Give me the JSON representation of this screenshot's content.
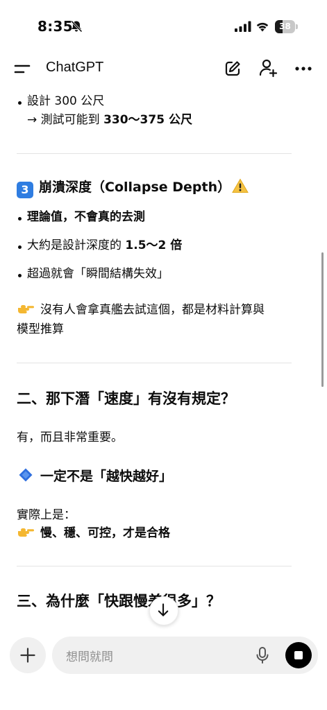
{
  "status_bar": {
    "time": "8:35",
    "battery_level": "38",
    "icons": [
      "bell-slash-icon",
      "signal-icon",
      "wifi-icon",
      "battery-icon"
    ]
  },
  "header": {
    "title": "ChatGPT",
    "icons": [
      "menu-icon",
      "compose-icon",
      "add-person-icon",
      "more-icon"
    ]
  },
  "message": {
    "design_line": "設計 300 公尺",
    "test_line_prefix": "→ 測試可能到 ",
    "test_line_bold": "330～375 公尺",
    "section3_keycap": "3",
    "section3_title": "崩潰深度（Collapse Depth）",
    "section3_items": [
      "理論值，不會真的去測",
      "大約是設計深度的 ",
      "超過就會「瞬間結構失效」"
    ],
    "section3_item2_bold": "1.5～2 倍",
    "section3_note_line1": "沒有人會拿真艦去試這個，都是材料計算與",
    "section3_note_line2": "模型推算",
    "heading2": "二、那下潛「速度」有沒有規定？",
    "answer": "有，而且非常重要。",
    "subheading": "一定不是「越快越好」",
    "actually": "實際上是：",
    "actually_bold": "慢、穩、可控，才是合格",
    "heading3": "三、為什麼「快跟慢差很多」？"
  },
  "composer": {
    "placeholder": "想問就問"
  },
  "colors": {
    "keycap_blue": "#2f7de1",
    "diamond_blue": "#2f6fde",
    "warning_yellow": "#f5c242",
    "point_yellow": "#f4b731"
  }
}
